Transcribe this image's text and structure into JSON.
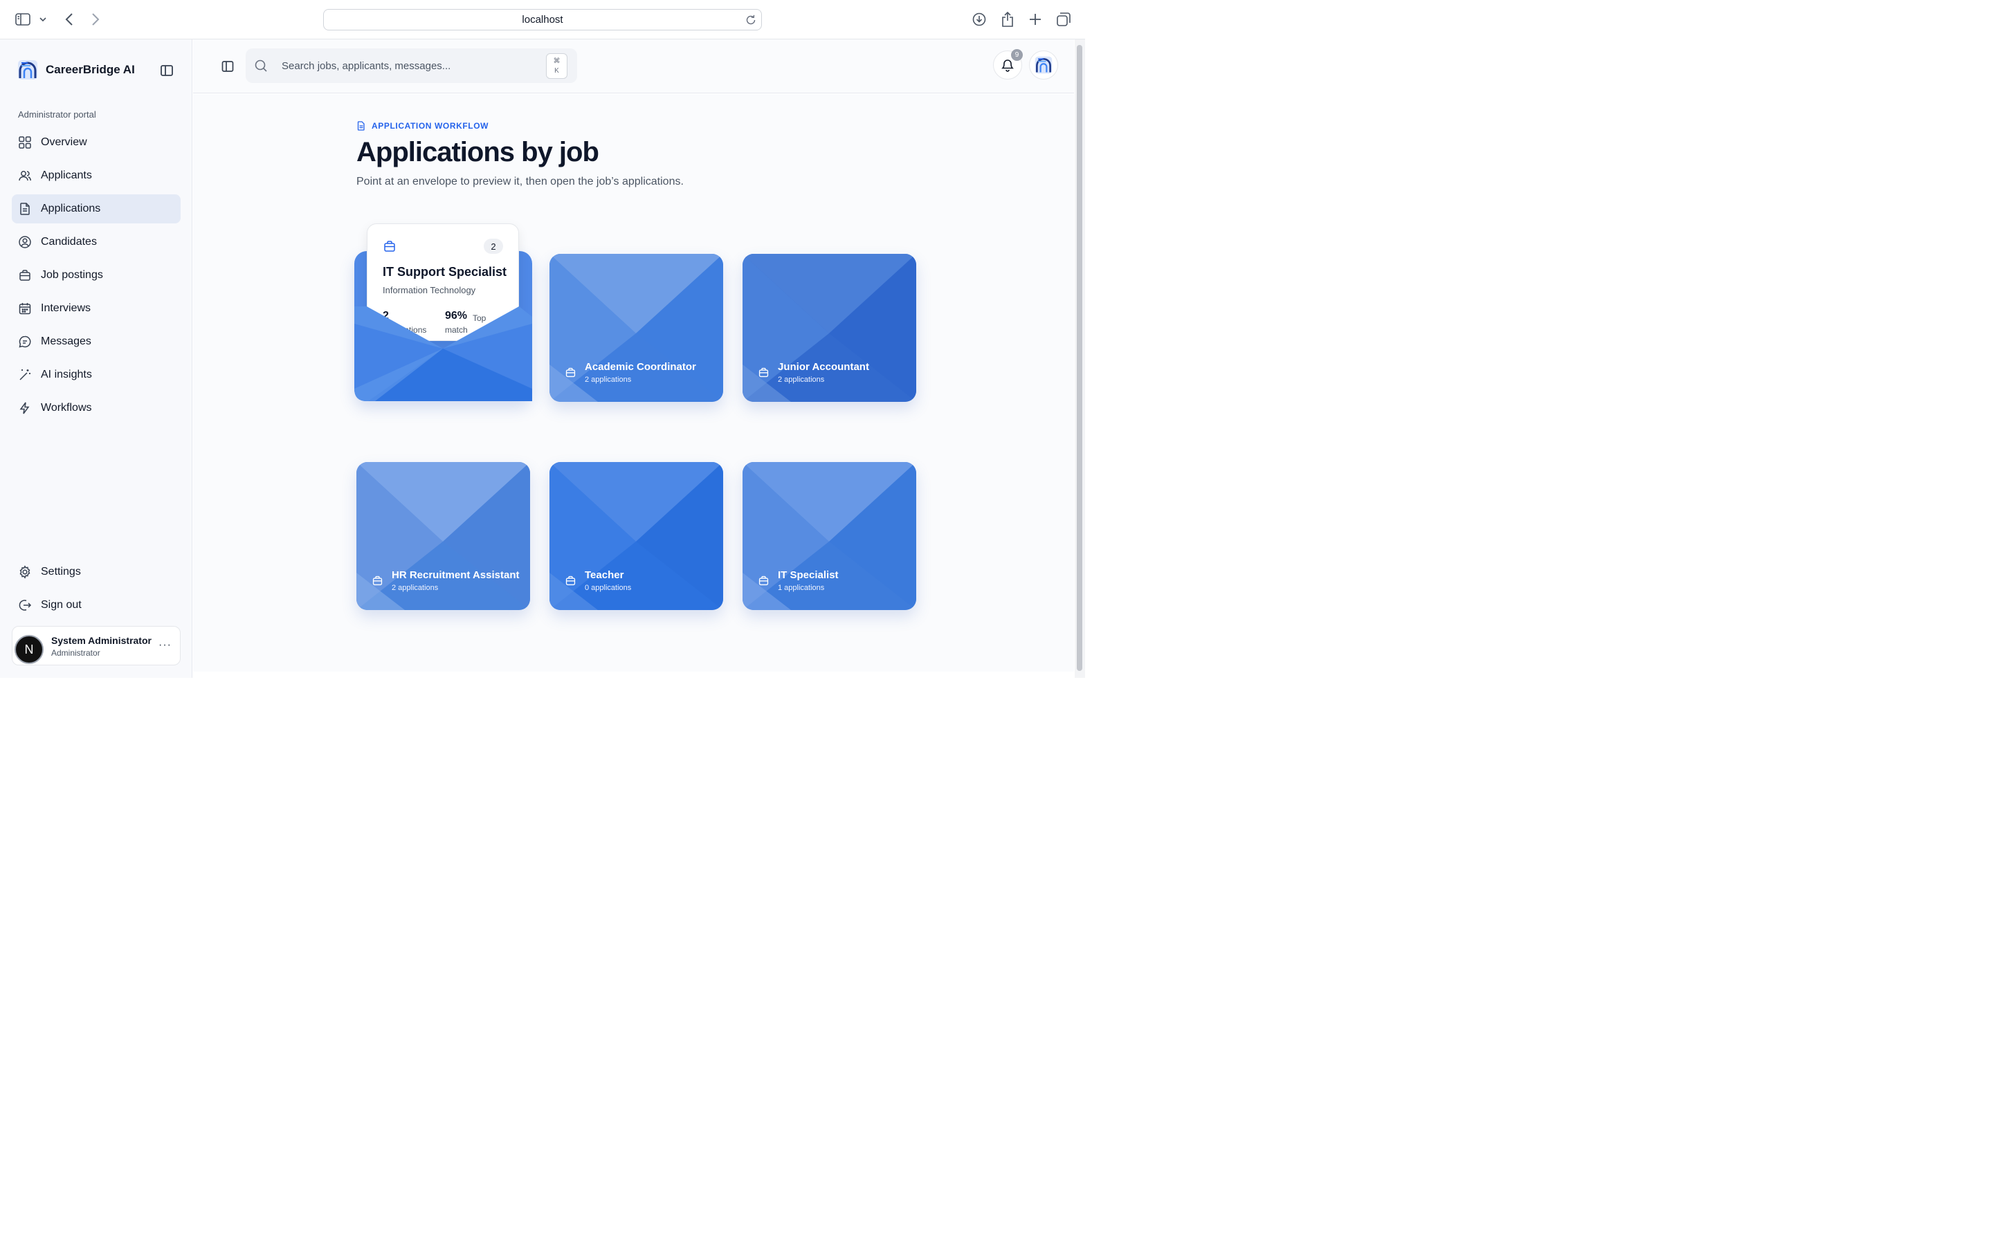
{
  "browser": {
    "url": "localhost"
  },
  "sidebar": {
    "brand": "CareerBridge AI",
    "portal_label": "Administrator portal",
    "items": [
      {
        "label": "Overview",
        "icon": "grid-icon",
        "active": false
      },
      {
        "label": "Applicants",
        "icon": "users-icon",
        "active": false
      },
      {
        "label": "Applications",
        "icon": "file-icon",
        "active": true
      },
      {
        "label": "Candidates",
        "icon": "user-circle-icon",
        "active": false
      },
      {
        "label": "Job postings",
        "icon": "briefcase-icon",
        "active": false
      },
      {
        "label": "Interviews",
        "icon": "calendar-icon",
        "active": false
      },
      {
        "label": "Messages",
        "icon": "message-icon",
        "active": false
      },
      {
        "label": "AI insights",
        "icon": "wand-icon",
        "active": false
      },
      {
        "label": "Workflows",
        "icon": "bolt-icon",
        "active": false
      }
    ],
    "bottom_items": [
      {
        "label": "Settings",
        "icon": "gear-icon"
      },
      {
        "label": "Sign out",
        "icon": "logout-icon"
      }
    ],
    "user": {
      "initial": "N",
      "name": "System Administrator",
      "role": "Administrator",
      "more": "···"
    }
  },
  "topbar": {
    "search_placeholder": "Search jobs, applicants, messages...",
    "shortcut_top": "⌘",
    "shortcut_bottom": "K",
    "notification_count": "9"
  },
  "page": {
    "eyebrow": "APPLICATION WORKFLOW",
    "title": "Applications by job",
    "subtitle": "Point at an envelope to preview it, then open the job’s applications."
  },
  "open_envelope": {
    "title": "IT Support Specialist",
    "department": "Information Technology",
    "count": "2",
    "applications_num": "2",
    "applications_label": "applications",
    "match_num": "96%",
    "match_label_1": "Top",
    "match_label_2": "match"
  },
  "envelopes": [
    {
      "title": "Academic Coordinator",
      "subtitle": "2 applications"
    },
    {
      "title": "Junior Accountant",
      "subtitle": "2 applications"
    },
    {
      "title": "HR Recruitment Assistant",
      "subtitle": "2 applications"
    },
    {
      "title": "Teacher",
      "subtitle": "0 applications"
    },
    {
      "title": "IT Specialist",
      "subtitle": "1 applications"
    }
  ],
  "colors": {
    "accent": "#2563eb",
    "envelope_base": "#3b7be0",
    "active_nav": "#e4eaf6"
  }
}
